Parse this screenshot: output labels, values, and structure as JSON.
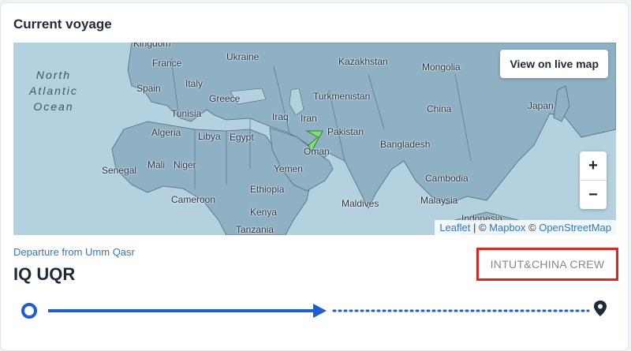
{
  "section": {
    "title": "Current voyage"
  },
  "map": {
    "ocean_label": "North\nAtlantic\nOcean",
    "live_map_button": "View on live map",
    "zoom_in": "+",
    "zoom_out": "−",
    "labels": {
      "kingdom": "Kingdom",
      "ukraine": "Ukraine",
      "kazakhstan": "Kazakhstan",
      "mongolia": "Mongolia",
      "france": "France",
      "spain": "Spain",
      "italy": "Italy",
      "greece": "Greece",
      "turkmenistan": "Turkmenistan",
      "tunisia": "Tunisia",
      "japan": "Japan",
      "china": "China",
      "iraq": "Iraq",
      "iran": "Iran",
      "algeria": "Algeria",
      "libya": "Libya",
      "egypt": "Egypt",
      "pakistan": "Pakistan",
      "oman": "Oman",
      "bangladesh": "Bangladesh",
      "senegal": "Senegal",
      "mali": "Mali",
      "niger": "Niger",
      "yemen": "Yemen",
      "cambodia": "Cambodia",
      "ethiopia": "Ethiopia",
      "cameroon": "Cameroon",
      "maldives": "Maldives",
      "malaysia": "Malaysia",
      "kenya": "Kenya",
      "indonesia": "Indonesia",
      "tanzania": "Tanzania"
    },
    "attribution": {
      "leaflet": "Leaflet",
      "sep1": " | © ",
      "mapbox": "Mapbox",
      "sep2": " © ",
      "osm": "OpenStreetMap"
    },
    "colors": {
      "water": "#b3d1df",
      "land": "#8eb1c4",
      "border": "#4e6b7c",
      "vessel": "#7fe07a"
    }
  },
  "voyage": {
    "departure_text": "Departure from Umm Qasr",
    "port_code": "IQ UQR",
    "crew_label": "INTUT&CHINA CREW",
    "progress_colors": {
      "line": "#1c5fd1",
      "highlight": "#e0241f"
    }
  },
  "icons": {
    "origin": "origin-circle-icon",
    "arrow": "arrow-right-icon",
    "destination": "location-pin-icon",
    "vessel": "vessel-marker-icon"
  }
}
